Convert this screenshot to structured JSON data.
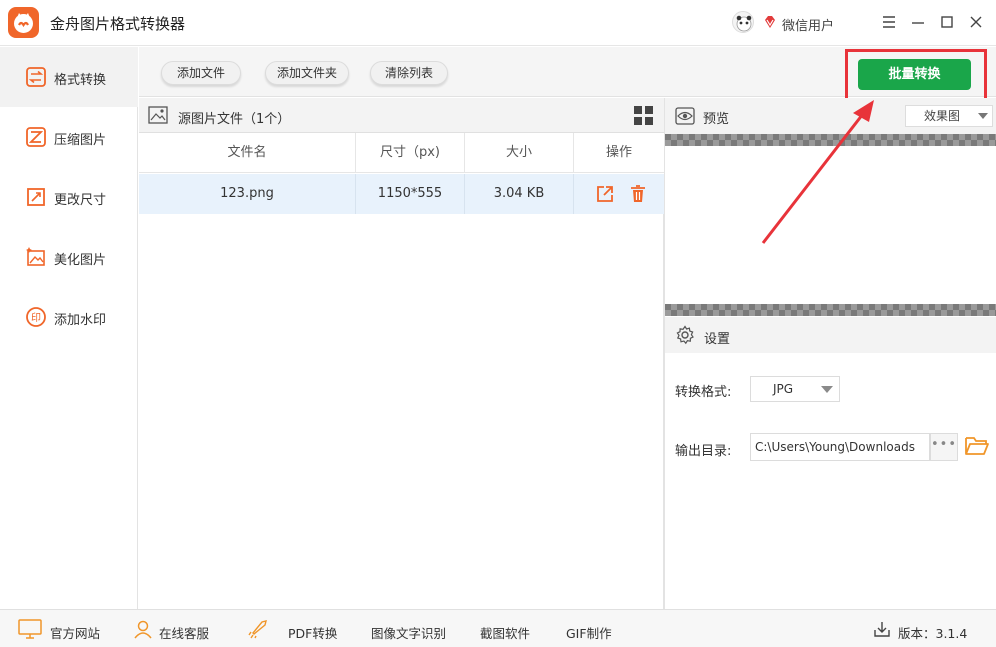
{
  "app": {
    "title": "金舟图片格式转换器"
  },
  "user": {
    "name": "微信用户"
  },
  "sidebar": {
    "items": [
      {
        "label": "格式转换",
        "icon": "swap-icon",
        "active": true
      },
      {
        "label": "压缩图片",
        "icon": "compress-icon",
        "active": false
      },
      {
        "label": "更改尺寸",
        "icon": "resize-icon",
        "active": false
      },
      {
        "label": "美化图片",
        "icon": "beautify-icon",
        "active": false
      },
      {
        "label": "添加水印",
        "icon": "watermark-icon",
        "active": false
      }
    ]
  },
  "toolbar": {
    "add_file": "添加文件",
    "add_folder": "添加文件夹",
    "clear_list": "清除列表",
    "batch_convert": "批量转换"
  },
  "file_list": {
    "title": "源图片文件（1个）",
    "columns": [
      "文件名",
      "尺寸（px)",
      "大小",
      "操作"
    ],
    "rows": [
      {
        "name": "123.png",
        "dimensions": "1150*555",
        "size": "3.04 KB"
      }
    ]
  },
  "preview": {
    "label": "预览",
    "mode": "效果图"
  },
  "settings": {
    "label": "设置",
    "format_label": "转换格式:",
    "format_value": "JPG",
    "output_label": "输出目录:",
    "output_path": "C:\\Users\\Young\\Downloads",
    "more": "•••"
  },
  "bottom": {
    "website": "官方网站",
    "support": "在线客服",
    "pdf": "PDF转换",
    "ocr": "图像文字识别",
    "screenshot": "截图软件",
    "gif": "GIF制作",
    "version": "版本：3.1.4"
  },
  "colors": {
    "accent_orange": "#f0662a",
    "batch_green": "#1aa64a",
    "annotation_red": "#e8333a",
    "row_highlight": "#e8f2fc"
  }
}
